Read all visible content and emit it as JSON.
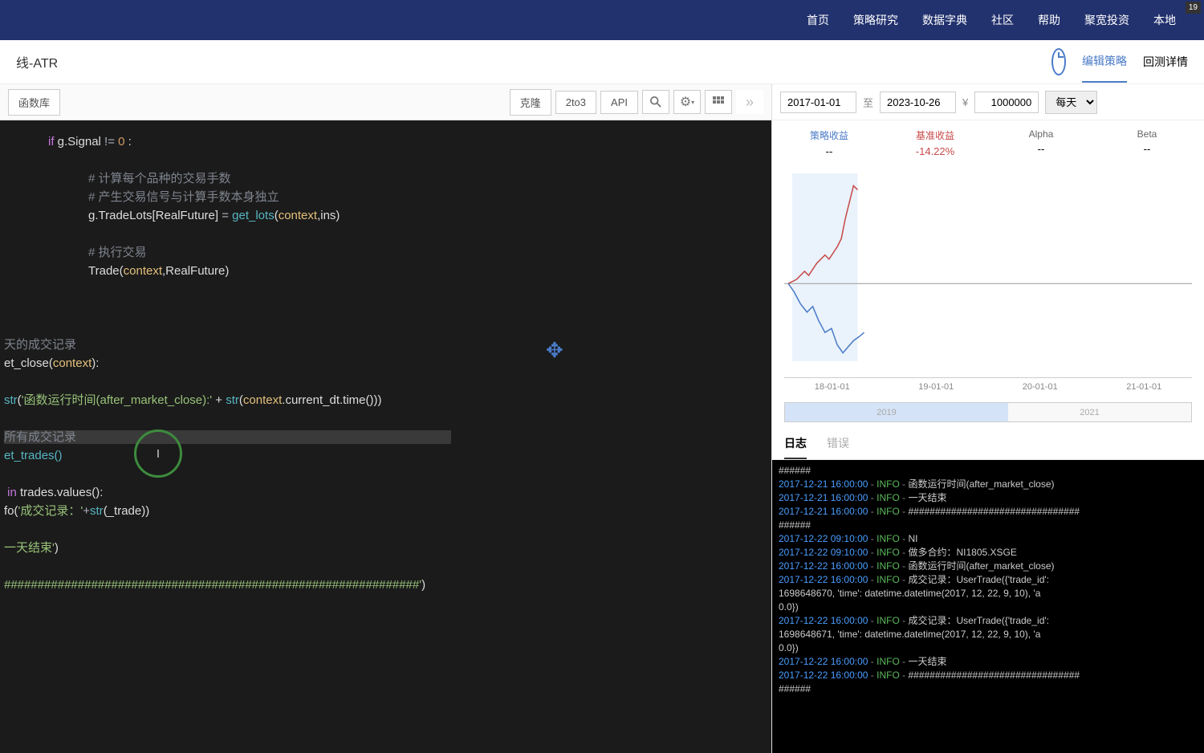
{
  "nav": {
    "items": [
      "首页",
      "策略研究",
      "数据字典",
      "社区",
      "帮助",
      "聚宽投资",
      "本地"
    ],
    "badge": "19"
  },
  "header": {
    "title": "线-ATR",
    "tabs": {
      "edit": "编辑策略",
      "detail": "回测详情"
    }
  },
  "toolbar": {
    "funclib": "函数库",
    "clone": "克隆",
    "to3": "2to3",
    "api": "API",
    "more": "»"
  },
  "params": {
    "start": "2017-01-01",
    "sep": "至",
    "end": "2023-10-26",
    "currency": "¥",
    "capital": "1000000",
    "freq": "每天"
  },
  "metrics": {
    "m1": {
      "lbl": "策略收益",
      "val": "--"
    },
    "m2": {
      "lbl": "基准收益",
      "val": "-14.22%"
    },
    "m3": {
      "lbl": "Alpha",
      "val": "--"
    },
    "m4": {
      "lbl": "Beta",
      "val": "--"
    }
  },
  "axis": {
    "t1": "18-01-01",
    "t2": "19-01-01",
    "t3": "20-01-01",
    "t4": "21-01-01"
  },
  "slider": {
    "y1": "2019",
    "y2": "2021"
  },
  "logtabs": {
    "log": "日志",
    "err": "错误"
  },
  "code": {
    "l1a": "if",
    "l1b": " g.Signal ",
    "l1c": "!=",
    "l1d": " 0 ",
    "l1e": ":",
    "c1": "# 计算每个品种的交易手数",
    "c2": "# 产生交易信号与计算手数本身独立",
    "l2a": "g.TradeLots[RealFuture] ",
    "l2b": "=",
    "l2c": " get_lots",
    "l2d": "(",
    "l2e": "context",
    "l2f": ",ins)",
    "c3": "# 执行交易",
    "l3a": "Trade(",
    "l3b": "context",
    "l3c": ",RealFuture)",
    "c4": "天的成交记录",
    "l4a": "et_close(",
    "l4b": "context",
    "l4c": "):",
    "l5a": "str",
    "l5b": "(",
    "l5c": "'函数运行时间(after_market_close):'",
    "l5d": " + ",
    "l5e": "str",
    "l5f": "(",
    "l5g": "context",
    "l5h": ".current_dt.time()))",
    ")": ")",
    "c5": "所有成交记录",
    "l6": "et_trades()",
    "l7a": " in",
    "l7b": " trades.values():",
    "l8a": "fo(",
    "l8b": "'成交记录：'",
    "l8c": "+",
    "l8d": "str",
    "l8e": "(_trade))",
    "l9a": "一天结束'",
    "l9b": ")",
    "l10a": "##############################################################'",
    "l10b": ")"
  },
  "logs": [
    {
      "pre": "######"
    },
    {
      "ts": "2017-12-21 16:00:00",
      "lv": "INFO",
      "msg": "函数运行时间(after_market_close)"
    },
    {
      "ts": "2017-12-21 16:00:00",
      "lv": "INFO",
      "msg": "一天结束"
    },
    {
      "ts": "2017-12-21 16:00:00",
      "lv": "INFO",
      "msg": "################################"
    },
    {
      "pre": "######"
    },
    {
      "ts": "2017-12-22 09:10:00",
      "lv": "INFO",
      "msg": "NI"
    },
    {
      "ts": "2017-12-22 09:10:00",
      "lv": "INFO",
      "msg": "做多合约：NI1805.XSGE"
    },
    {
      "ts": "2017-12-22 16:00:00",
      "lv": "INFO",
      "msg": "函数运行时间(after_market_close)"
    },
    {
      "ts": "2017-12-22 16:00:00",
      "lv": "INFO",
      "msg": "成交记录：UserTrade({'trade_id':"
    },
    {
      "cont": "1698648670, 'time': datetime.datetime(2017, 12, 22, 9, 10), 'a"
    },
    {
      "cont": "0.0})"
    },
    {
      "ts": "2017-12-22 16:00:00",
      "lv": "INFO",
      "msg": "成交记录：UserTrade({'trade_id':"
    },
    {
      "cont": "1698648671, 'time': datetime.datetime(2017, 12, 22, 9, 10), 'a"
    },
    {
      "cont": "0.0})"
    },
    {
      "ts": "2017-12-22 16:00:00",
      "lv": "INFO",
      "msg": "一天结束"
    },
    {
      "ts": "2017-12-22 16:00:00",
      "lv": "INFO",
      "msg": "################################"
    },
    {
      "pre": "######"
    }
  ],
  "chart_data": {
    "type": "line",
    "xlabel": "date",
    "ylabel": "return",
    "series": [
      {
        "name": "策略收益",
        "color": "#c84a4a",
        "values": [
          0,
          2,
          5,
          3,
          8,
          12,
          18,
          15,
          22,
          30,
          45,
          52,
          60
        ]
      },
      {
        "name": "基准收益",
        "color": "#4a7bc8",
        "values": [
          0,
          -5,
          -10,
          -8,
          -18,
          -25,
          -22,
          -30,
          -35,
          -28,
          -20,
          -15,
          -14
        ]
      }
    ],
    "x_ticks": [
      "18-01-01",
      "19-01-01",
      "20-01-01",
      "21-01-01"
    ],
    "ylim": [
      -40,
      70
    ]
  }
}
